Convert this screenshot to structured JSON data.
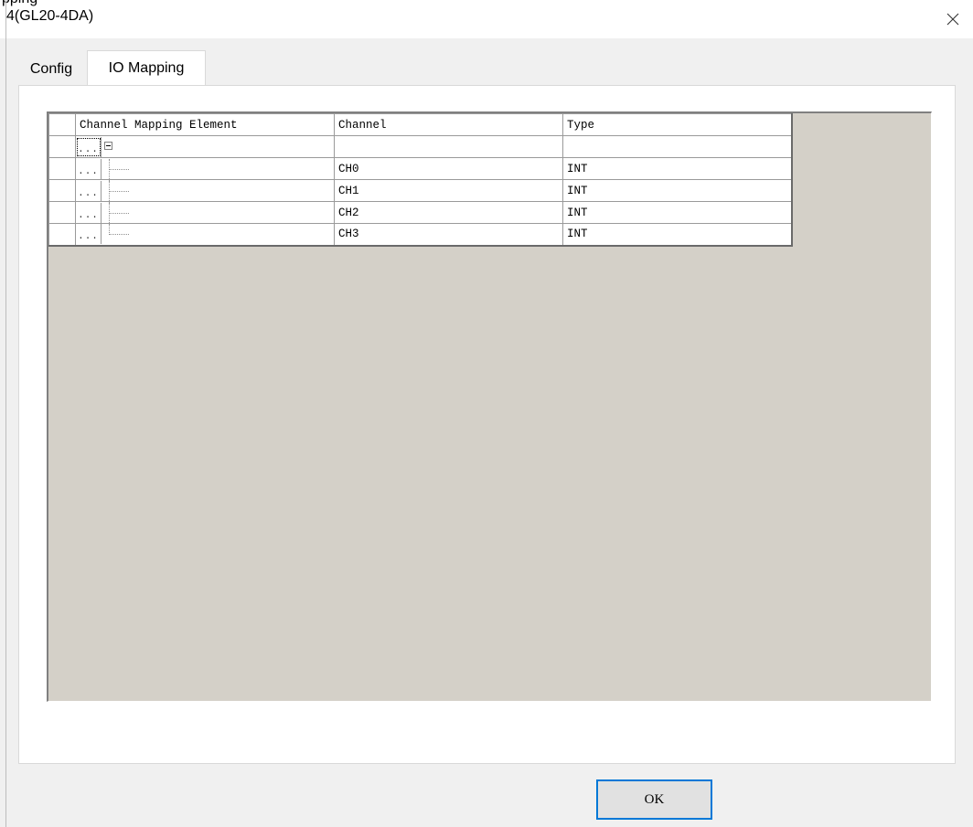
{
  "window": {
    "clipped_text": "pping",
    "title": "4(GL20-4DA)",
    "close_glyph": "×"
  },
  "tabs": [
    {
      "label": "Config",
      "active": false
    },
    {
      "label": "IO Mapping",
      "active": true
    }
  ],
  "table": {
    "headers": {
      "element": "Channel Mapping Element",
      "channel": "Channel",
      "type": "Type"
    },
    "row_button_label": "...",
    "rows": [
      {
        "channel": "",
        "type": ""
      },
      {
        "channel": "CH0",
        "type": "INT"
      },
      {
        "channel": "CH1",
        "type": "INT"
      },
      {
        "channel": "CH2",
        "type": "INT"
      },
      {
        "channel": "CH3",
        "type": "INT"
      }
    ]
  },
  "buttons": {
    "ok_label": "OK"
  },
  "colors": {
    "accent": "#0078d7",
    "grid_background": "#d4d0c8"
  },
  "icons": {
    "close": "close-icon",
    "tree_toggle": "collapse-icon"
  }
}
